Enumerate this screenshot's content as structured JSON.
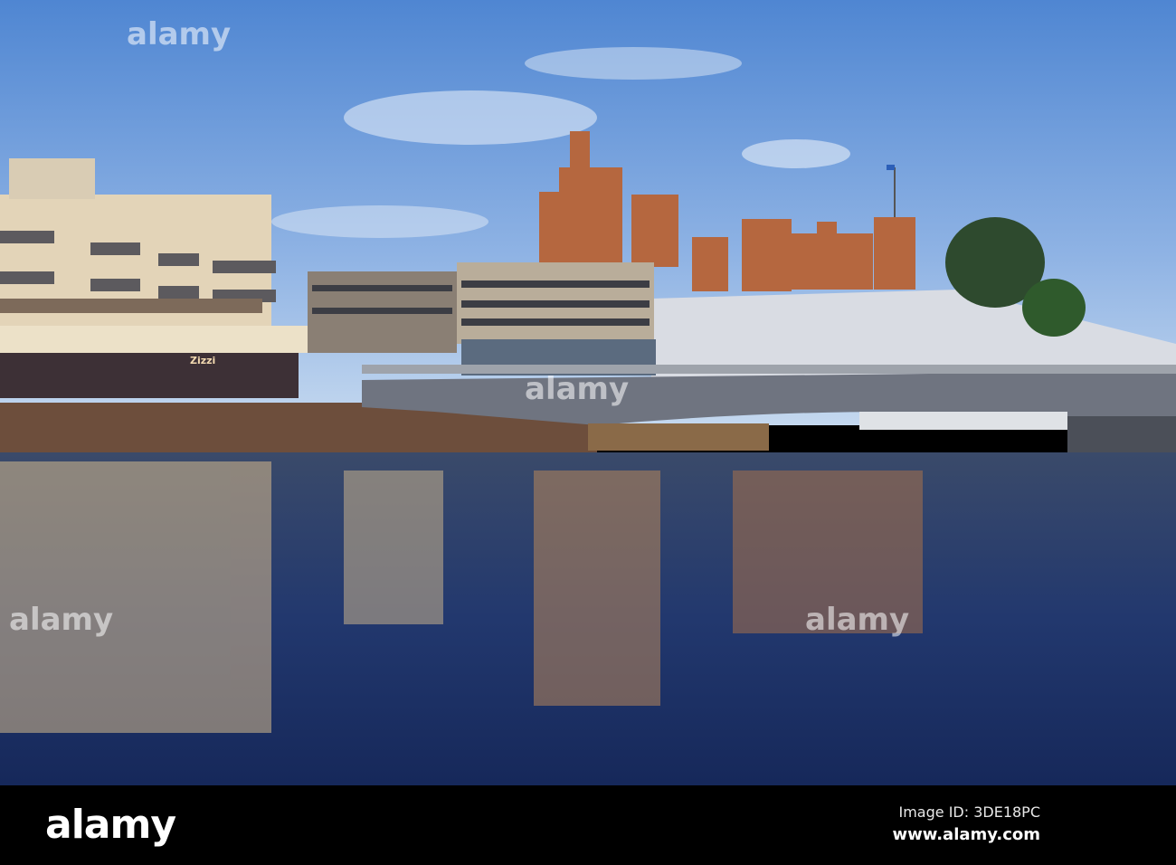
{
  "photo": {
    "storefront_sign": "Zizzi",
    "colors": {
      "sky_top": "#5b8fd6",
      "sky_bottom": "#bcd3ee",
      "water": "#1c2f63",
      "castle": "#b5673f",
      "bar": "#000000"
    }
  },
  "watermark": {
    "text": "alamy"
  },
  "footer": {
    "logo": "alamy",
    "image_id": "Image ID: 3DE18PC",
    "website": "www.alamy.com"
  }
}
